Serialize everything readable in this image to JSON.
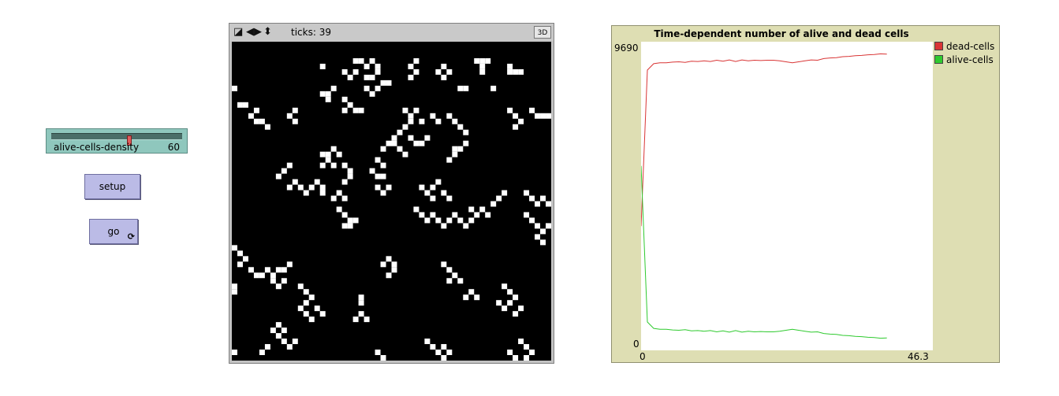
{
  "slider": {
    "label": "alive-cells-density",
    "value": "60",
    "fraction": 0.6
  },
  "buttons": {
    "setup": "setup",
    "go": "go",
    "go_loop_symbol": "⟳"
  },
  "view": {
    "ticks_label": "ticks: 39",
    "three_d_label": "3D",
    "grid_size": 58,
    "alive_cells": [
      [
        16,
        4
      ],
      [
        22,
        3
      ],
      [
        23,
        3
      ],
      [
        25,
        3
      ],
      [
        24,
        4
      ],
      [
        26,
        4
      ],
      [
        26,
        5
      ],
      [
        22,
        5
      ],
      [
        20,
        5
      ],
      [
        21,
        6
      ],
      [
        24,
        6
      ],
      [
        25,
        6
      ],
      [
        27,
        7
      ],
      [
        28,
        7
      ],
      [
        26,
        8
      ],
      [
        24,
        8
      ],
      [
        25,
        9
      ],
      [
        38,
        4
      ],
      [
        37,
        5
      ],
      [
        39,
        5
      ],
      [
        38,
        6
      ],
      [
        33,
        3
      ],
      [
        32,
        4
      ],
      [
        33,
        5
      ],
      [
        32,
        6
      ],
      [
        44,
        3
      ],
      [
        45,
        3
      ],
      [
        46,
        3
      ],
      [
        45,
        4
      ],
      [
        45,
        5
      ],
      [
        50,
        4
      ],
      [
        50,
        5
      ],
      [
        51,
        5
      ],
      [
        52,
        5
      ],
      [
        0,
        8
      ],
      [
        1,
        11
      ],
      [
        2,
        11
      ],
      [
        4,
        12
      ],
      [
        3,
        13
      ],
      [
        4,
        14
      ],
      [
        5,
        14
      ],
      [
        6,
        15
      ],
      [
        11,
        12
      ],
      [
        10,
        13
      ],
      [
        11,
        14
      ],
      [
        17,
        9
      ],
      [
        18,
        8
      ],
      [
        16,
        9
      ],
      [
        17,
        10
      ],
      [
        20,
        10
      ],
      [
        21,
        11
      ],
      [
        22,
        12
      ],
      [
        20,
        12
      ],
      [
        23,
        12
      ],
      [
        31,
        12
      ],
      [
        32,
        13
      ],
      [
        33,
        12
      ],
      [
        32,
        14
      ],
      [
        31,
        15
      ],
      [
        30,
        16
      ],
      [
        32,
        17
      ],
      [
        33,
        18
      ],
      [
        34,
        18
      ],
      [
        35,
        17
      ],
      [
        34,
        14
      ],
      [
        36,
        13
      ],
      [
        37,
        14
      ],
      [
        39,
        13
      ],
      [
        40,
        14
      ],
      [
        41,
        15
      ],
      [
        42,
        16
      ],
      [
        42,
        18
      ],
      [
        41,
        19
      ],
      [
        40,
        19
      ],
      [
        40,
        20
      ],
      [
        39,
        21
      ],
      [
        50,
        12
      ],
      [
        51,
        13
      ],
      [
        52,
        14
      ],
      [
        51,
        15
      ],
      [
        41,
        8
      ],
      [
        42,
        8
      ],
      [
        47,
        8
      ],
      [
        54,
        12
      ],
      [
        55,
        13
      ],
      [
        56,
        13
      ],
      [
        57,
        13
      ],
      [
        27,
        19
      ],
      [
        28,
        18
      ],
      [
        29,
        18
      ],
      [
        29,
        17
      ],
      [
        30,
        19
      ],
      [
        31,
        20
      ],
      [
        26,
        21
      ],
      [
        27,
        22
      ],
      [
        16,
        20
      ],
      [
        17,
        20
      ],
      [
        18,
        19
      ],
      [
        19,
        20
      ],
      [
        17,
        21
      ],
      [
        16,
        22
      ],
      [
        18,
        22
      ],
      [
        20,
        22
      ],
      [
        21,
        23
      ],
      [
        21,
        24
      ],
      [
        20,
        25
      ],
      [
        9,
        23
      ],
      [
        10,
        22
      ],
      [
        8,
        24
      ],
      [
        11,
        25
      ],
      [
        10,
        26
      ],
      [
        12,
        26
      ],
      [
        13,
        27
      ],
      [
        14,
        26
      ],
      [
        16,
        27
      ],
      [
        15,
        25
      ],
      [
        16,
        26
      ],
      [
        25,
        23
      ],
      [
        26,
        24
      ],
      [
        27,
        24
      ],
      [
        26,
        26
      ],
      [
        27,
        27
      ],
      [
        28,
        26
      ],
      [
        18,
        28
      ],
      [
        19,
        27
      ],
      [
        20,
        28
      ],
      [
        19,
        30
      ],
      [
        20,
        31
      ],
      [
        21,
        32
      ],
      [
        22,
        32
      ],
      [
        21,
        33
      ],
      [
        20,
        33
      ],
      [
        34,
        26
      ],
      [
        35,
        27
      ],
      [
        36,
        26
      ],
      [
        37,
        25
      ],
      [
        38,
        27
      ],
      [
        39,
        28
      ],
      [
        36,
        28
      ],
      [
        33,
        30
      ],
      [
        34,
        31
      ],
      [
        36,
        31
      ],
      [
        35,
        32
      ],
      [
        37,
        32
      ],
      [
        38,
        33
      ],
      [
        39,
        32
      ],
      [
        40,
        31
      ],
      [
        41,
        32
      ],
      [
        42,
        33
      ],
      [
        43,
        32
      ],
      [
        44,
        31
      ],
      [
        43,
        30
      ],
      [
        45,
        30
      ],
      [
        46,
        31
      ],
      [
        47,
        29
      ],
      [
        48,
        28
      ],
      [
        49,
        27
      ],
      [
        53,
        27
      ],
      [
        54,
        28
      ],
      [
        55,
        29
      ],
      [
        56,
        28
      ],
      [
        57,
        29
      ],
      [
        53,
        31
      ],
      [
        54,
        32
      ],
      [
        55,
        33
      ],
      [
        56,
        34
      ],
      [
        57,
        33
      ],
      [
        55,
        35
      ],
      [
        56,
        36
      ],
      [
        0,
        37
      ],
      [
        1,
        38
      ],
      [
        2,
        39
      ],
      [
        1,
        40
      ],
      [
        3,
        41
      ],
      [
        4,
        42
      ],
      [
        5,
        42
      ],
      [
        6,
        41
      ],
      [
        7,
        42
      ],
      [
        8,
        41
      ],
      [
        9,
        41
      ],
      [
        10,
        40
      ],
      [
        9,
        43
      ],
      [
        8,
        44
      ],
      [
        7,
        43
      ],
      [
        27,
        40
      ],
      [
        28,
        39
      ],
      [
        29,
        40
      ],
      [
        28,
        42
      ],
      [
        29,
        41
      ],
      [
        38,
        40
      ],
      [
        39,
        41
      ],
      [
        40,
        42
      ],
      [
        39,
        43
      ],
      [
        41,
        43
      ],
      [
        43,
        45
      ],
      [
        44,
        46
      ],
      [
        42,
        46
      ],
      [
        12,
        44
      ],
      [
        13,
        45
      ],
      [
        14,
        46
      ],
      [
        13,
        47
      ],
      [
        12,
        48
      ],
      [
        13,
        49
      ],
      [
        14,
        50
      ],
      [
        16,
        49
      ],
      [
        15,
        48
      ],
      [
        23,
        46
      ],
      [
        23,
        47
      ],
      [
        23,
        49
      ],
      [
        22,
        50
      ],
      [
        24,
        50
      ],
      [
        49,
        44
      ],
      [
        50,
        45
      ],
      [
        51,
        46
      ],
      [
        50,
        47
      ],
      [
        49,
        48
      ],
      [
        48,
        47
      ],
      [
        52,
        48
      ],
      [
        51,
        49
      ],
      [
        7,
        52
      ],
      [
        8,
        51
      ],
      [
        9,
        52
      ],
      [
        8,
        53
      ],
      [
        9,
        54
      ],
      [
        10,
        55
      ],
      [
        11,
        54
      ],
      [
        6,
        55
      ],
      [
        5,
        56
      ],
      [
        35,
        54
      ],
      [
        36,
        55
      ],
      [
        37,
        56
      ],
      [
        38,
        55
      ],
      [
        39,
        56
      ],
      [
        52,
        54
      ],
      [
        53,
        55
      ],
      [
        54,
        56
      ],
      [
        53,
        57
      ],
      [
        51,
        57
      ],
      [
        50,
        56
      ],
      [
        5,
        61
      ],
      [
        6,
        62
      ],
      [
        4,
        62
      ],
      [
        7,
        63
      ],
      [
        8,
        64
      ],
      [
        9,
        63
      ],
      [
        0,
        63
      ],
      [
        0,
        64
      ],
      [
        0,
        56
      ],
      [
        0,
        44
      ],
      [
        0,
        45
      ],
      [
        14,
        65
      ],
      [
        15,
        66
      ],
      [
        16,
        65
      ],
      [
        17,
        64
      ],
      [
        18,
        63
      ],
      [
        19,
        62
      ],
      [
        20,
        63
      ],
      [
        21,
        64
      ],
      [
        22,
        65
      ],
      [
        23,
        64
      ],
      [
        12,
        68
      ],
      [
        11,
        69
      ],
      [
        13,
        69
      ],
      [
        12,
        70
      ],
      [
        17,
        68
      ],
      [
        18,
        69
      ],
      [
        19,
        70
      ],
      [
        20,
        69
      ],
      [
        21,
        70
      ],
      [
        22,
        71
      ],
      [
        23,
        70
      ],
      [
        38,
        57
      ],
      [
        39,
        58
      ],
      [
        40,
        59
      ],
      [
        41,
        60
      ],
      [
        42,
        61
      ],
      [
        26,
        56
      ],
      [
        27,
        57
      ],
      [
        28,
        58
      ],
      [
        49,
        69
      ],
      [
        50,
        68
      ],
      [
        51,
        69
      ],
      [
        52,
        70
      ],
      [
        56,
        68
      ],
      [
        57,
        69
      ],
      [
        56,
        70
      ],
      [
        55,
        69
      ],
      [
        31,
        67
      ],
      [
        32,
        68
      ],
      [
        33,
        69
      ],
      [
        34,
        68
      ],
      [
        24,
        62
      ],
      [
        25,
        63
      ],
      [
        26,
        64
      ],
      [
        45,
        63
      ],
      [
        46,
        64
      ],
      [
        47,
        65
      ]
    ]
  },
  "plot": {
    "title": "Time-dependent number of alive and dead cells",
    "ymax_label": "9690",
    "ymin_label": "0",
    "xmin_label": "0",
    "xmax_label": "46.3",
    "legend": [
      {
        "name": "dead-cells",
        "color": "#d93535"
      },
      {
        "name": "alive-cells",
        "color": "#2fca2f"
      }
    ]
  },
  "chart_data": {
    "type": "line",
    "title": "Time-dependent number of alive and dead cells",
    "xlim": [
      0,
      46.3
    ],
    "ylim": [
      0,
      9690
    ],
    "series": [
      {
        "name": "dead-cells",
        "color": "#d93535",
        "x": [
          0,
          1,
          2,
          3,
          4,
          5,
          6,
          7,
          8,
          9,
          10,
          11,
          12,
          13,
          14,
          15,
          16,
          17,
          18,
          19,
          20,
          21,
          22,
          23,
          24,
          25,
          26,
          27,
          28,
          29,
          30,
          31,
          32,
          33,
          34,
          35,
          36,
          37,
          38,
          39
        ],
        "y": [
          3900,
          8800,
          9000,
          9030,
          9030,
          9050,
          9060,
          9040,
          9080,
          9070,
          9090,
          9070,
          9110,
          9080,
          9120,
          9070,
          9120,
          9090,
          9110,
          9100,
          9110,
          9110,
          9090,
          9060,
          9030,
          9060,
          9090,
          9120,
          9110,
          9160,
          9180,
          9190,
          9220,
          9230,
          9250,
          9260,
          9280,
          9290,
          9310,
          9300
        ]
      },
      {
        "name": "alive-cells",
        "color": "#2fca2f",
        "x": [
          0,
          1,
          2,
          3,
          4,
          5,
          6,
          7,
          8,
          9,
          10,
          11,
          12,
          13,
          14,
          15,
          16,
          17,
          18,
          19,
          20,
          21,
          22,
          23,
          24,
          25,
          26,
          27,
          28,
          29,
          30,
          31,
          32,
          33,
          34,
          35,
          36,
          37,
          38,
          39
        ],
        "y": [
          5790,
          890,
          690,
          660,
          660,
          640,
          630,
          650,
          610,
          620,
          600,
          620,
          580,
          610,
          570,
          620,
          570,
          600,
          580,
          590,
          580,
          580,
          600,
          630,
          660,
          630,
          600,
          570,
          580,
          530,
          510,
          500,
          470,
          460,
          440,
          430,
          410,
          400,
          380,
          390
        ]
      }
    ]
  }
}
